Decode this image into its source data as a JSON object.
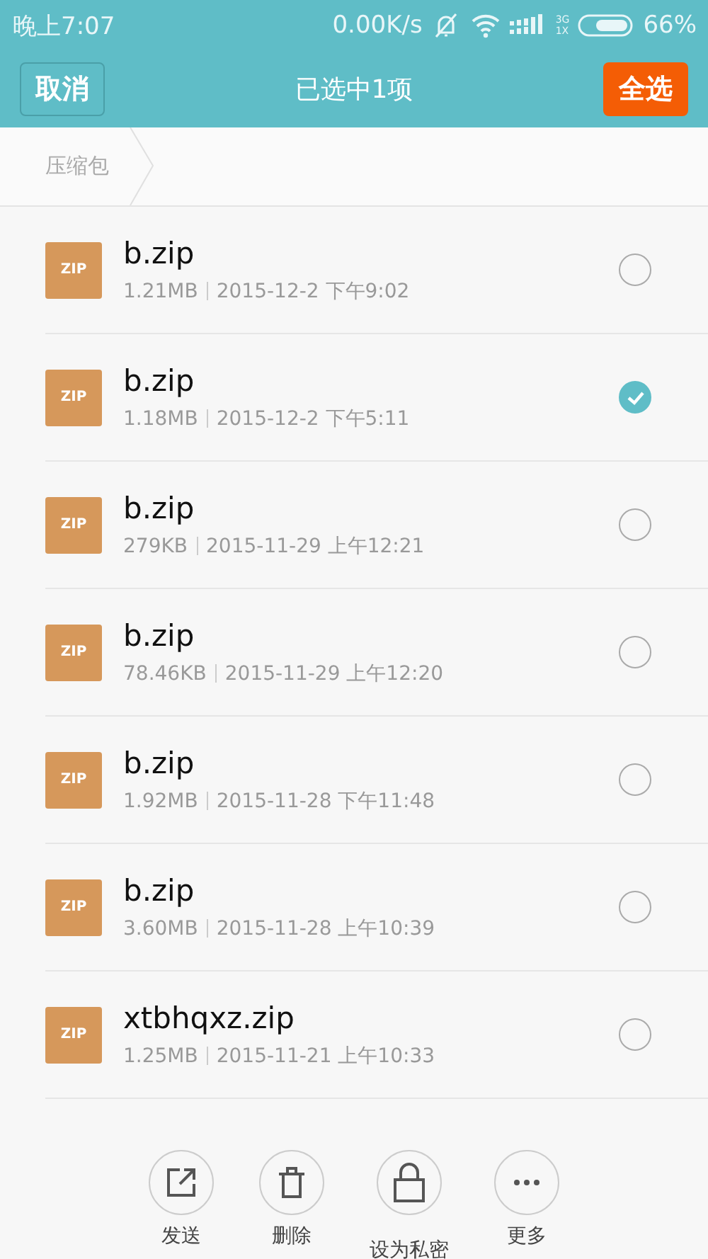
{
  "status_bar": {
    "time": "晚上7:07",
    "speed": "0.00K/s",
    "network": "3G",
    "network_2": "1X",
    "battery": "66%"
  },
  "header": {
    "cancel": "取消",
    "title": "已选中1项",
    "select_all": "全选"
  },
  "breadcrumb": [
    "压缩包"
  ],
  "files": [
    {
      "icon": "ZIP",
      "name": "b.zip",
      "size": "1.21MB",
      "date": "2015-12-2 下午9:02",
      "selected": false
    },
    {
      "icon": "ZIP",
      "name": "b.zip",
      "size": "1.18MB",
      "date": "2015-12-2 下午5:11",
      "selected": true
    },
    {
      "icon": "ZIP",
      "name": "b.zip",
      "size": "279KB",
      "date": "2015-11-29 上午12:21",
      "selected": false
    },
    {
      "icon": "ZIP",
      "name": "b.zip",
      "size": "78.46KB",
      "date": "2015-11-29 上午12:20",
      "selected": false
    },
    {
      "icon": "ZIP",
      "name": "b.zip",
      "size": "1.92MB",
      "date": "2015-11-28 下午11:48",
      "selected": false
    },
    {
      "icon": "ZIP",
      "name": "b.zip",
      "size": "3.60MB",
      "date": "2015-11-28 上午10:39",
      "selected": false
    },
    {
      "icon": "ZIP",
      "name": "xtbhqxz.zip",
      "size": "1.25MB",
      "date": "2015-11-21 上午10:33",
      "selected": false
    }
  ],
  "actions": [
    {
      "kind": "send",
      "label": "发送"
    },
    {
      "kind": "delete",
      "label": "删除"
    },
    {
      "kind": "lock",
      "label": "设为私密"
    },
    {
      "kind": "more",
      "label": "更多"
    }
  ]
}
